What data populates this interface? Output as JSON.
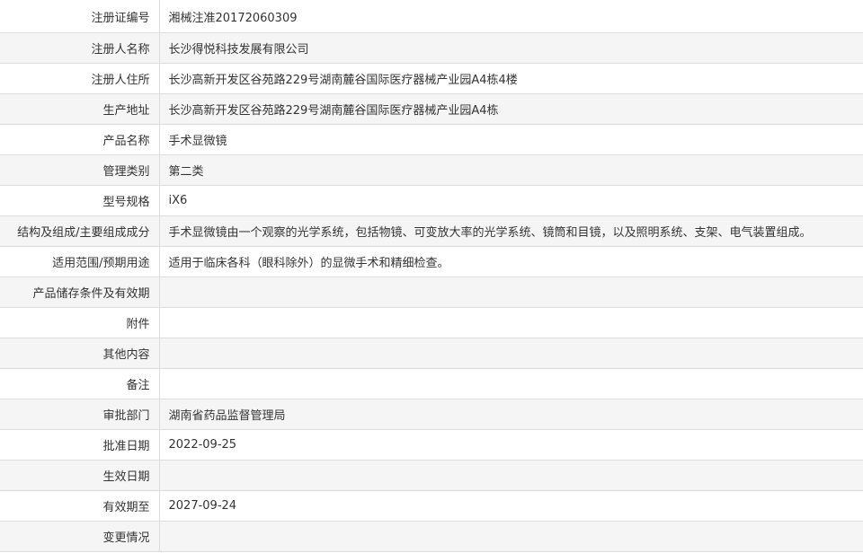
{
  "rows": [
    {
      "label": "注册证编号",
      "value": "湘械注准20172060309"
    },
    {
      "label": "注册人名称",
      "value": "长沙得悦科技发展有限公司"
    },
    {
      "label": "注册人住所",
      "value": "长沙高新开发区谷苑路229号湖南麓谷国际医疗器械产业园A4栋4楼"
    },
    {
      "label": "生产地址",
      "value": "长沙高新开发区谷苑路229号湖南麓谷国际医疗器械产业园A4栋"
    },
    {
      "label": "产品名称",
      "value": "手术显微镜"
    },
    {
      "label": "管理类别",
      "value": "第二类"
    },
    {
      "label": "型号规格",
      "value": "iX6"
    },
    {
      "label": "结构及组成/主要组成成分",
      "value": "手术显微镜由一个观察的光学系统，包括物镜、可变放大率的光学系统、镜筒和目镜，以及照明系统、支架、电气装置组成。"
    },
    {
      "label": "适用范围/预期用途",
      "value": "适用于临床各科（眼科除外）的显微手术和精细检查。"
    },
    {
      "label": "产品储存条件及有效期",
      "value": ""
    },
    {
      "label": "附件",
      "value": ""
    },
    {
      "label": "其他内容",
      "value": ""
    },
    {
      "label": "备注",
      "value": ""
    },
    {
      "label": "审批部门",
      "value": "湖南省药品监督管理局"
    },
    {
      "label": "批准日期",
      "value": "2022-09-25"
    },
    {
      "label": "生效日期",
      "value": ""
    },
    {
      "label": "有效期至",
      "value": "2027-09-24"
    },
    {
      "label": "变更情况",
      "value": ""
    }
  ]
}
